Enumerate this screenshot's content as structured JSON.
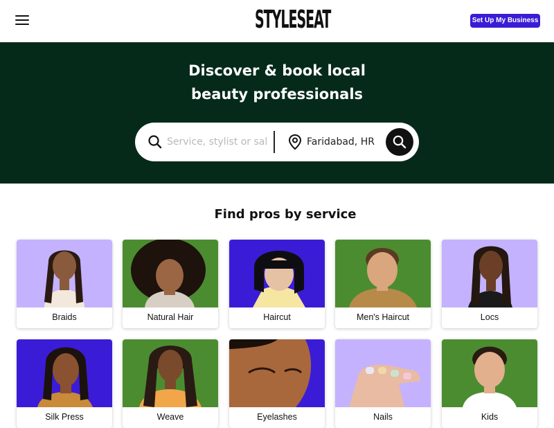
{
  "header": {
    "logo_text": "STYLESEAT",
    "cta_label": "Set Up My Business"
  },
  "hero": {
    "title_line1": "Discover & book local",
    "title_line2": "beauty professionals",
    "service_placeholder": "Service, stylist or salon",
    "location_value": "Faridabad, HR"
  },
  "section": {
    "title": "Find pros by service"
  },
  "services": [
    {
      "label": "Braids",
      "bg": "#c4b2ff"
    },
    {
      "label": "Natural Hair",
      "bg": "#4c8c30"
    },
    {
      "label": "Haircut",
      "bg": "#3b1cd6"
    },
    {
      "label": "Men's Haircut",
      "bg": "#4c8c30"
    },
    {
      "label": "Locs",
      "bg": "#c4b2ff"
    },
    {
      "label": "Silk Press",
      "bg": "#3b1cd6"
    },
    {
      "label": "Weave",
      "bg": "#4c8c30"
    },
    {
      "label": "Eyelashes",
      "bg": "#3b1cd6"
    },
    {
      "label": "Nails",
      "bg": "#c4b2ff"
    },
    {
      "label": "Kids",
      "bg": "#4c8c30"
    }
  ],
  "colors": {
    "hero_bg": "#052a1a",
    "brand_purple": "#3b1cd6",
    "lavender": "#c4b2ff",
    "green": "#4c8c30"
  },
  "icons": {
    "menu": "hamburger-menu-icon",
    "search": "search-icon",
    "location": "location-pin-icon",
    "submit": "search-icon"
  }
}
